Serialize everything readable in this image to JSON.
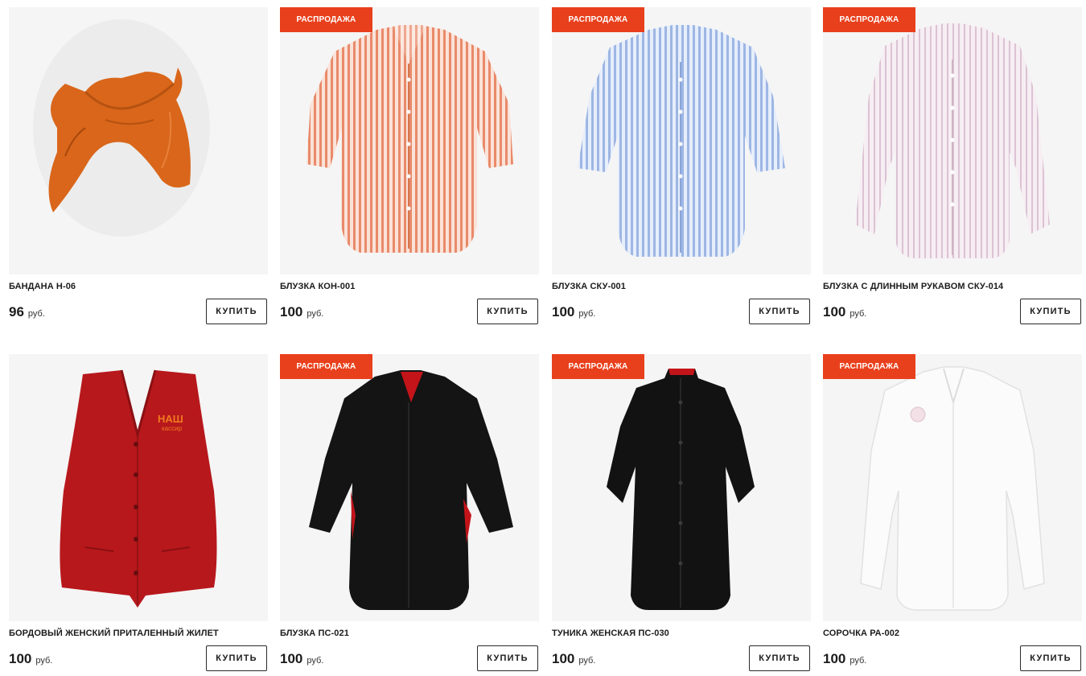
{
  "products": [
    {
      "badge": "",
      "name": "БАНДАНА Н-06",
      "price": "96",
      "currency": "руб.",
      "buy_label": "КУПИТЬ",
      "image": "orange-bandana"
    },
    {
      "badge": "РАСПРОДАЖА",
      "name": "БЛУЗКА КОН-001",
      "price": "100",
      "currency": "руб.",
      "buy_label": "КУПИТЬ",
      "image": "coral-striped-short-sleeve-blouse"
    },
    {
      "badge": "РАСПРОДАЖА",
      "name": "БЛУЗКА СКУ-001",
      "price": "100",
      "currency": "руб.",
      "buy_label": "КУПИТЬ",
      "image": "blue-striped-short-sleeve-blouse"
    },
    {
      "badge": "РАСПРОДАЖА",
      "name": "БЛУЗКА С ДЛИННЫМ РУКАВОМ СКУ-014",
      "price": "100",
      "currency": "руб.",
      "buy_label": "КУПИТЬ",
      "image": "pink-striped-long-sleeve-blouse"
    },
    {
      "badge": "",
      "name": "БОРДОВЫЙ ЖЕНСКИЙ ПРИТАЛЕННЫЙ ЖИЛЕТ",
      "price": "100",
      "currency": "руб.",
      "buy_label": "КУПИТЬ",
      "image": "burgundy-vest",
      "logo_text_line1": "НАШ",
      "logo_text_line2": "кассир"
    },
    {
      "badge": "РАСПРОДАЖА",
      "name": "БЛУЗКА ПС-021",
      "price": "100",
      "currency": "руб.",
      "buy_label": "КУПИТЬ",
      "image": "black-blouse-red-trim"
    },
    {
      "badge": "РАСПРОДАЖА",
      "name": "ТУНИКА ЖЕНСКАЯ ПС-030",
      "price": "100",
      "currency": "руб.",
      "buy_label": "КУПИТЬ",
      "image": "black-tunic"
    },
    {
      "badge": "РАСПРОДАЖА",
      "name": "СОРОЧКА РА-002",
      "price": "100",
      "currency": "руб.",
      "buy_label": "КУПИТЬ",
      "image": "white-long-sleeve-shirt"
    }
  ],
  "colors": {
    "badge_bg": "#e8401c",
    "photo_bg": "#f5f5f5",
    "text": "#1b1b1b"
  }
}
